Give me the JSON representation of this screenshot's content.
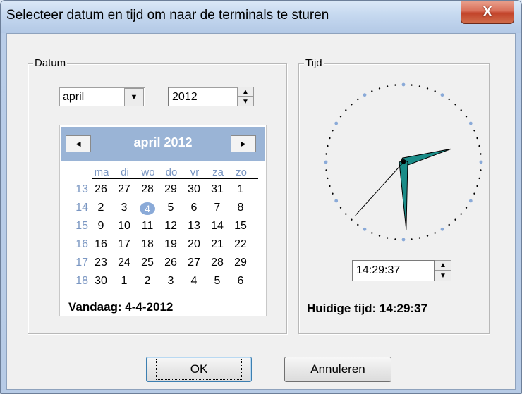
{
  "window": {
    "title": "Selecteer datum en tijd om naar de terminals te sturen",
    "close_glyph": "X"
  },
  "datum": {
    "group_label": "Datum",
    "month_select": {
      "value": "april"
    },
    "year_spin": {
      "value": "2012"
    }
  },
  "calendar": {
    "title": "april 2012",
    "prev_glyph": "◄",
    "next_glyph": "►",
    "weekdays": [
      "ma",
      "di",
      "wo",
      "do",
      "vr",
      "za",
      "zo"
    ],
    "weeks": [
      {
        "week": "13",
        "days": [
          "26",
          "27",
          "28",
          "29",
          "30",
          "31",
          "1"
        ]
      },
      {
        "week": "14",
        "days": [
          "2",
          "3",
          "4",
          "5",
          "6",
          "7",
          "8"
        ]
      },
      {
        "week": "15",
        "days": [
          "9",
          "10",
          "11",
          "12",
          "13",
          "14",
          "15"
        ]
      },
      {
        "week": "16",
        "days": [
          "16",
          "17",
          "18",
          "19",
          "20",
          "21",
          "22"
        ]
      },
      {
        "week": "17",
        "days": [
          "23",
          "24",
          "25",
          "26",
          "27",
          "28",
          "29"
        ]
      },
      {
        "week": "18",
        "days": [
          "30",
          "1",
          "2",
          "3",
          "4",
          "5",
          "6"
        ]
      }
    ],
    "selected_day": "4",
    "today_text": "Vandaag: 4-4-2012"
  },
  "tijd": {
    "group_label": "Tijd",
    "clock": {
      "hour": 14,
      "minute": 29,
      "second": 37,
      "hand_color": "#1a8c88"
    },
    "time_field": {
      "value": "14:29:37"
    },
    "current_time_text": "Huidige tijd: 14:29:37"
  },
  "buttons": {
    "ok_label": "OK",
    "cancel_label": "Annuleren"
  },
  "colors": {
    "calendar_header": "#9ab4d6",
    "week_number": "#7a96c2",
    "clock_dot_major": "#8aaad8"
  }
}
